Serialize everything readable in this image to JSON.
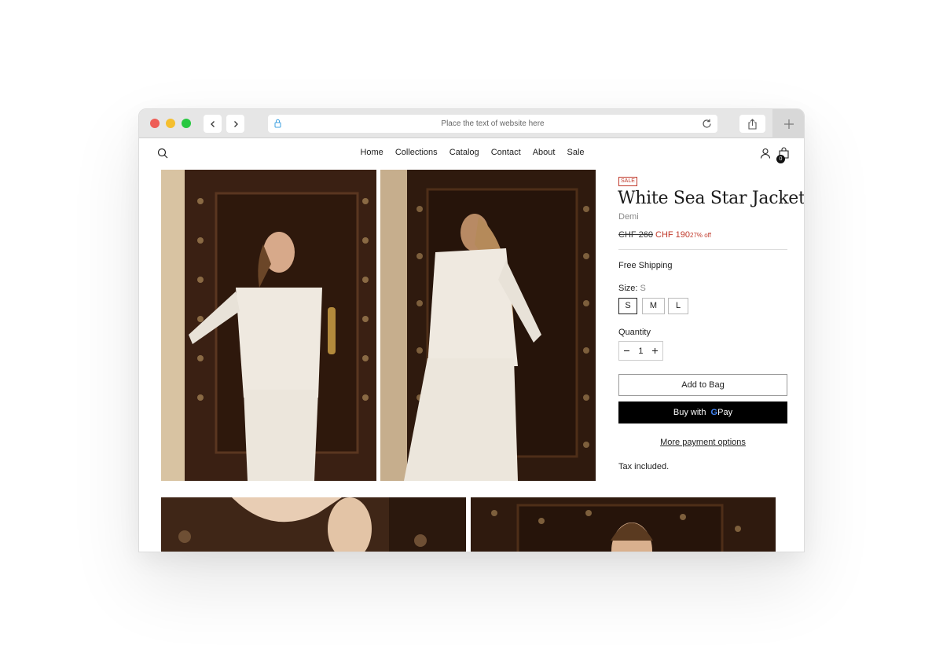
{
  "browser": {
    "url_placeholder": "Place the text of website here"
  },
  "nav": {
    "items": [
      "Home",
      "Collections",
      "Catalog",
      "Contact",
      "About",
      "Sale"
    ],
    "cart_count": "0"
  },
  "product": {
    "badge": "SALE",
    "title": "White Sea Star Jacket",
    "vendor": "Demi",
    "price_old": "CHF 260",
    "price_new": "CHF 190",
    "discount": "27% off",
    "shipping": "Free Shipping",
    "size_label": "Size:",
    "size_selected": "S",
    "sizes": [
      "S",
      "M",
      "L"
    ],
    "quantity_label": "Quantity",
    "quantity": "1",
    "add_to_bag": "Add to Bag",
    "buy_with": "Buy with",
    "gpay_g": "G",
    "gpay_pay": "Pay",
    "more_payment": "More payment options",
    "tax": "Tax included."
  },
  "colors": {
    "sale": "#c0392b",
    "button_dark": "#000000"
  },
  "icons": [
    "search-icon",
    "account-icon",
    "bag-icon",
    "lock-icon",
    "reload-icon",
    "share-icon",
    "plus-icon",
    "chevron-left-icon",
    "chevron-right-icon",
    "minus-icon"
  ]
}
